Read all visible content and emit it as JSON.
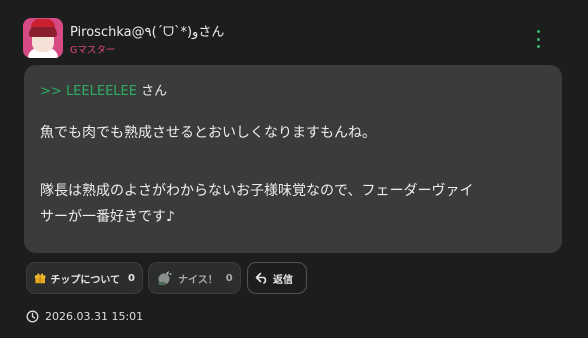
{
  "author": {
    "name": "Piroschka@٩(ˊᗜˋ*)وさん",
    "rank": "Gマスター"
  },
  "message": {
    "reply_prefix": ">>",
    "reply_target": "LEELEELEE",
    "reply_honorific": "さん",
    "paragraph_1": "魚でも肉でも熟成させるとおいしくなりますもんね。",
    "paragraph_2_line_1": "隊長は熟成のよさがわからないお子様味覚なので、フェーダーヴァイ",
    "paragraph_2_line_2": "サーが一番好きです♪"
  },
  "actions": {
    "tip_label": "チップについて",
    "tip_count": "0",
    "nice_label": "ナイス！",
    "nice_count": "0",
    "reply_label": "返信"
  },
  "timestamp": "2026.03.31 15:01",
  "colors": {
    "background": "#1c1e1e",
    "bubble": "#393c3b",
    "accent_green": "#2fae62",
    "rank_pink": "#e0457e"
  }
}
